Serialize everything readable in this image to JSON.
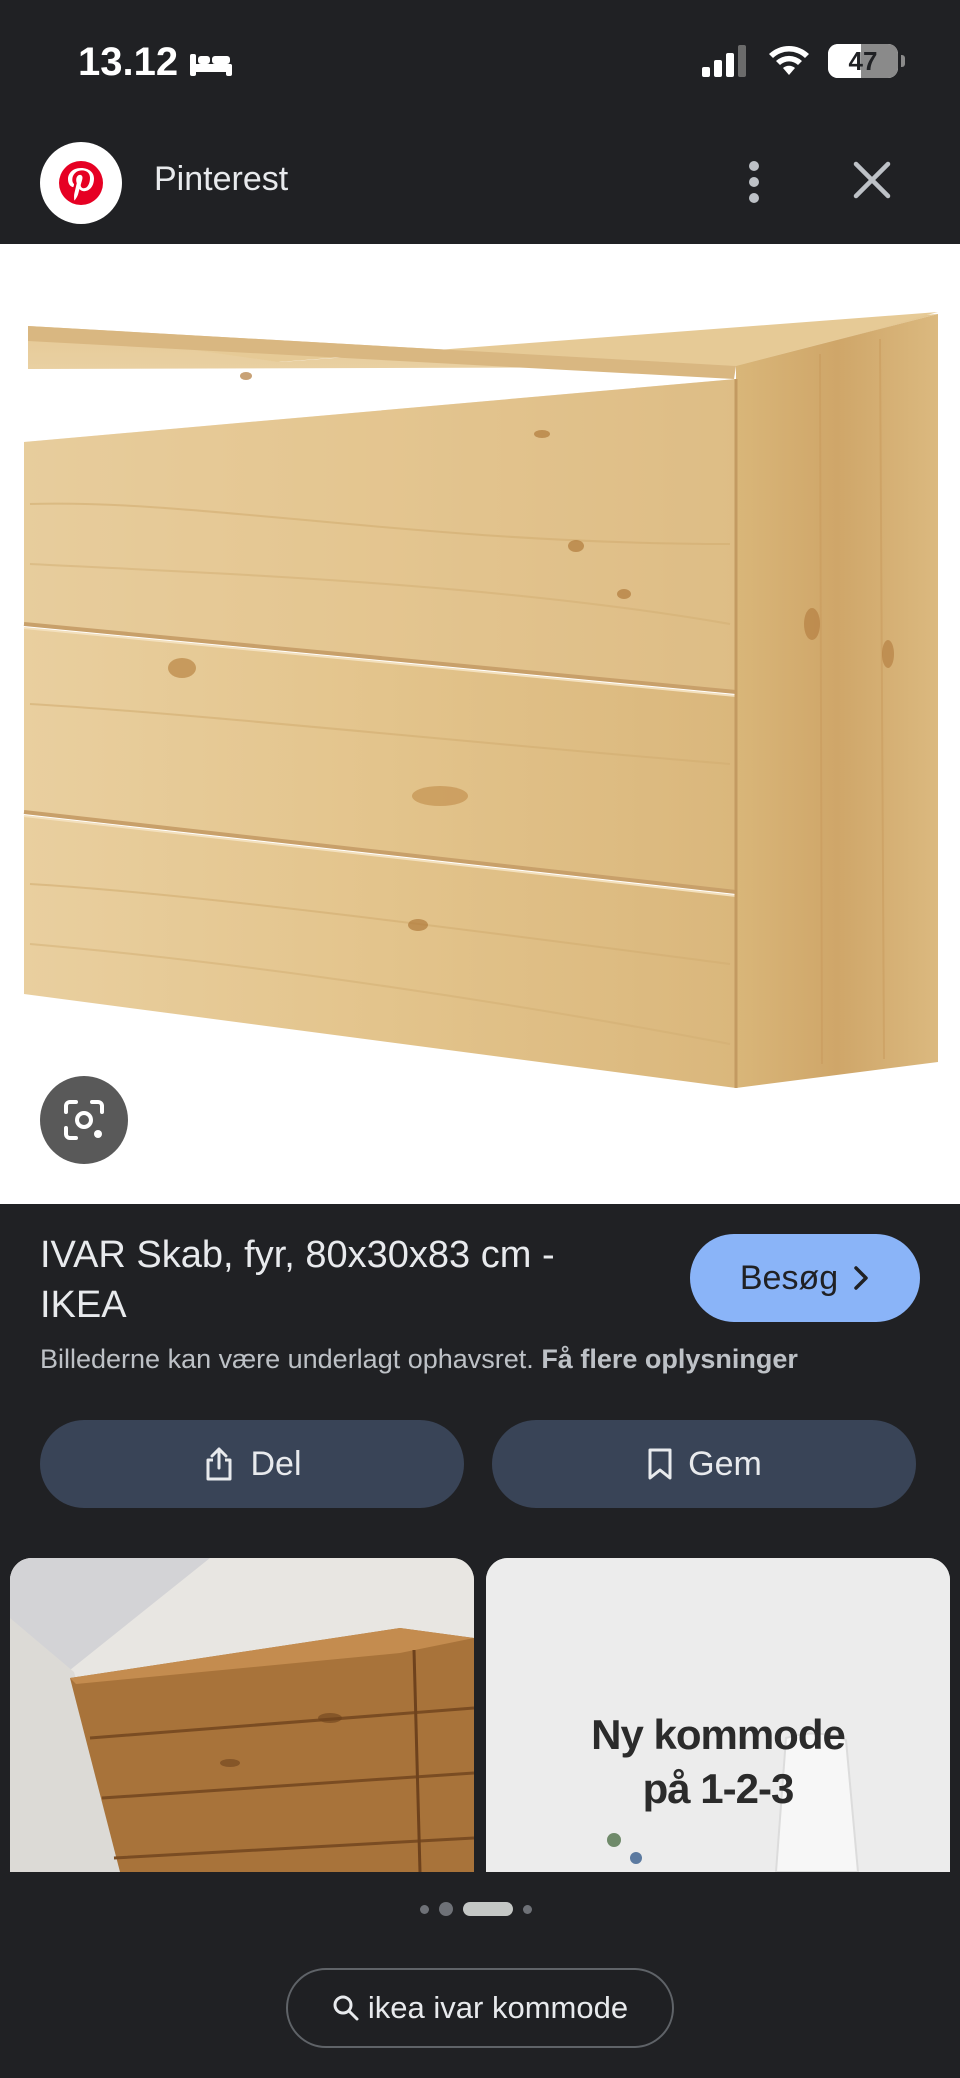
{
  "status_bar": {
    "time": "13.12",
    "battery_level": "47",
    "battery_fraction": 0.47,
    "icons": [
      "bed-icon",
      "signal-icon",
      "wifi-icon",
      "battery-icon"
    ]
  },
  "header": {
    "source_name": "Pinterest",
    "icons": [
      "pinterest-logo-icon",
      "more-vertical-icon",
      "close-icon"
    ]
  },
  "result": {
    "title": "IVAR Skab, fyr, 80x30x83 cm - IKEA",
    "visit_label": "Besøg",
    "copyright_text": "Billederne kan være underlagt ophavsret.",
    "more_info_link": "Få flere oplysninger",
    "share_label": "Del",
    "save_label": "Gem"
  },
  "related": {
    "thumb_2_caption_line1": "Ny kommode",
    "thumb_2_caption_line2": "på 1-2-3"
  },
  "pagination": {
    "dot_count": 4,
    "active_index": 2
  },
  "search": {
    "query": "ikea ivar kommode",
    "icon": "search-icon"
  },
  "colors": {
    "background": "#202124",
    "visit_button": "#8ab4f8",
    "action_button": "#394457",
    "pinterest_red": "#e60023",
    "wood": "#e2c48f"
  }
}
